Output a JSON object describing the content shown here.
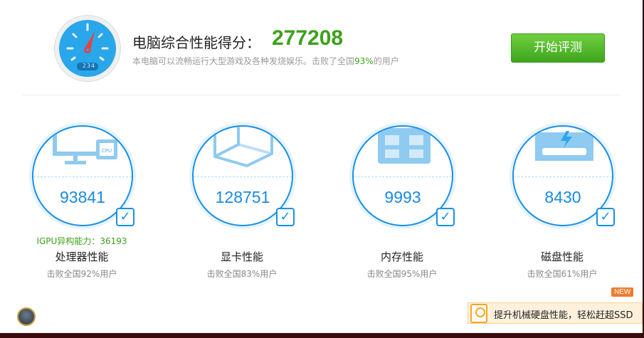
{
  "header": {
    "gauge_readout": "234",
    "title": "电脑综合性能得分：",
    "score": "277208",
    "sub_before": "本电脑可以流畅运行大型游戏及各种发烧娱乐。击败了全国",
    "sub_pct": "93%",
    "sub_after": "的用户",
    "start_button": "开始评测"
  },
  "cards": [
    {
      "score": "93841",
      "extra": "IGPU异构能力：36193",
      "name": "处理器性能",
      "beat": "击败全国92%用户",
      "icon": "cpu-monitor-icon"
    },
    {
      "score": "128751",
      "name": "显卡性能",
      "beat": "击败全国83%用户",
      "icon": "gpu-cube-icon"
    },
    {
      "score": "9993",
      "name": "内存性能",
      "beat": "击败全国95%用户",
      "icon": "memory-chip-icon"
    },
    {
      "score": "8430",
      "name": "磁盘性能",
      "beat": "击败全国61%用户",
      "icon": "disk-icon"
    }
  ],
  "promo": {
    "badge": "NEW",
    "text": "提升机械硬盘性能，轻松赶超SSD"
  },
  "colors": {
    "accent": "#1890e8",
    "green": "#3ca11b",
    "orange": "#f07b2e"
  }
}
